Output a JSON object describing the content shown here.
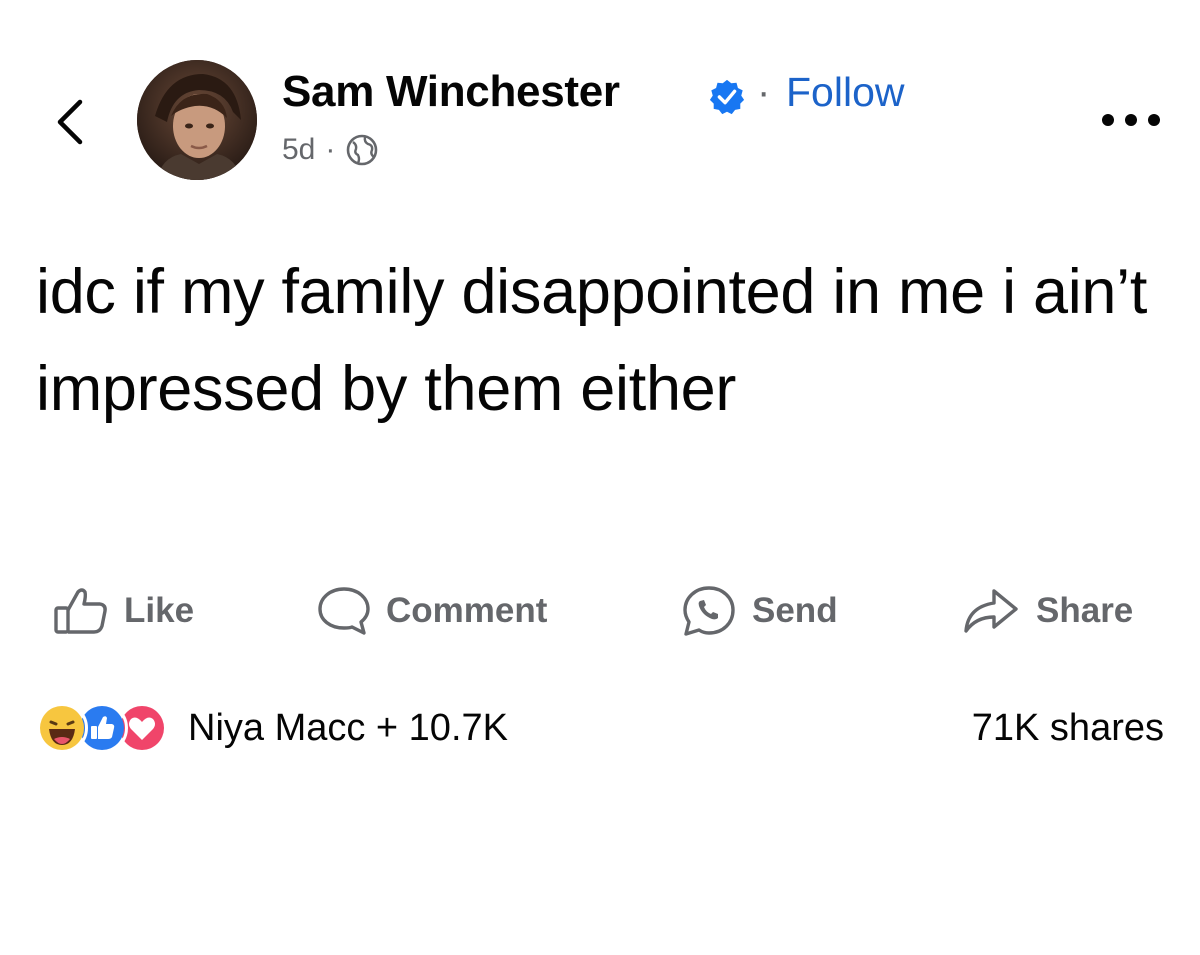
{
  "header": {
    "author_name": "Sam Winchester",
    "separator": "·",
    "follow_label": "Follow",
    "time": "5d",
    "meta_separator": "·",
    "back_icon": "chevron-left-icon",
    "verified_icon": "verified-badge-icon",
    "audience_icon": "globe-icon",
    "more_icon": "more-dots-icon"
  },
  "post": {
    "text": "idc if my family disappointed in me i ain’t impressed by them either"
  },
  "actions": [
    {
      "label": "Like",
      "icon": "thumbs-up-icon"
    },
    {
      "label": "Comment",
      "icon": "comment-icon"
    },
    {
      "label": "Send",
      "icon": "whatsapp-icon"
    },
    {
      "label": "Share",
      "icon": "share-arrow-icon"
    }
  ],
  "reactions": {
    "icons": [
      "haha-icon",
      "like-icon",
      "love-icon"
    ],
    "summary": "Niya Macc + 10.7K",
    "shares": "71K shares"
  },
  "colors": {
    "accent": "#1c63c9",
    "muted": "#65676b",
    "text": "#050505"
  }
}
